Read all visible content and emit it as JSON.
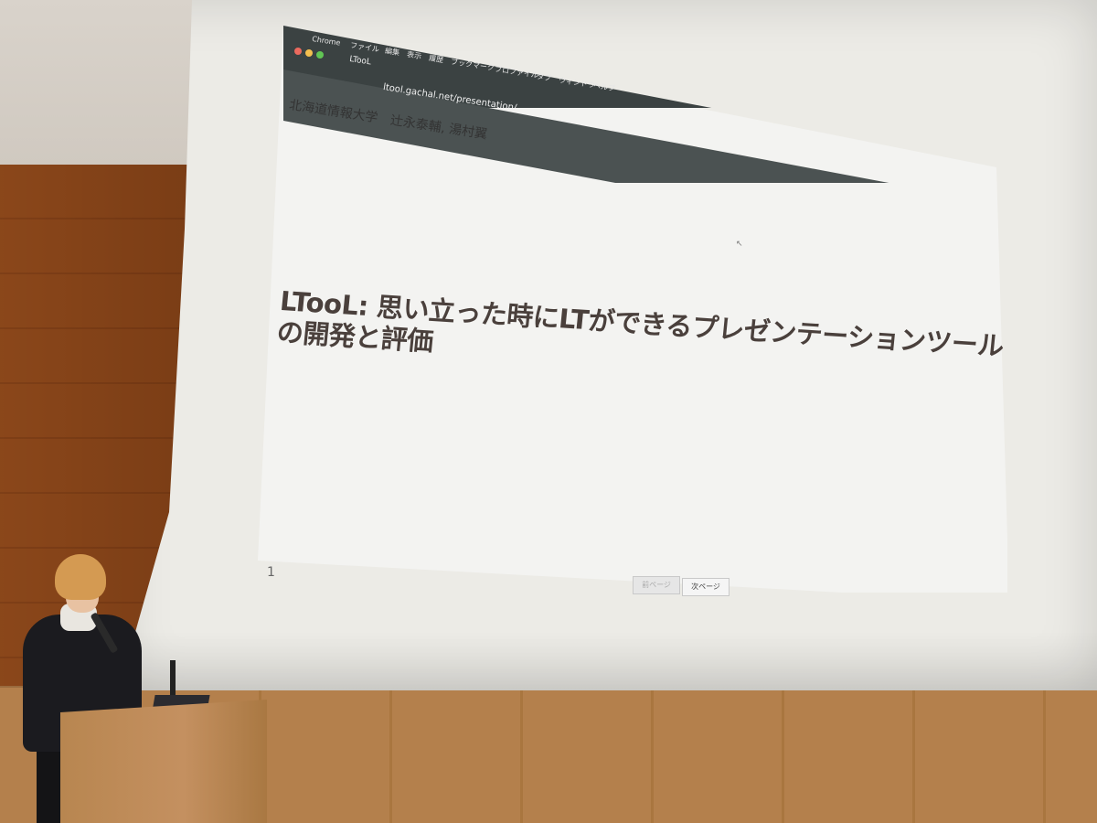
{
  "browser": {
    "app_menu": [
      "Chrome",
      "ファイル",
      "編集",
      "表示",
      "履歴",
      "ブックマーク",
      "プロファイル",
      "タブ",
      "ウィンドウ",
      "ヘルプ"
    ],
    "tab_title": "LTooL",
    "url": "ltool.gachal.net/presentation/"
  },
  "slide": {
    "authors": "北海道情報大学　辻永泰輔, 湯村翼",
    "title": "LTooL: 思い立った時にLTができるプレゼンテーションツールの開発と評価",
    "page_number": "1",
    "prev_button": "前ページ",
    "next_button": "次ページ"
  },
  "colors": {
    "screen": "#ecebe6",
    "browser_chrome": "#3b4242",
    "title_text": "#4a403c",
    "wood": "#b38455"
  }
}
